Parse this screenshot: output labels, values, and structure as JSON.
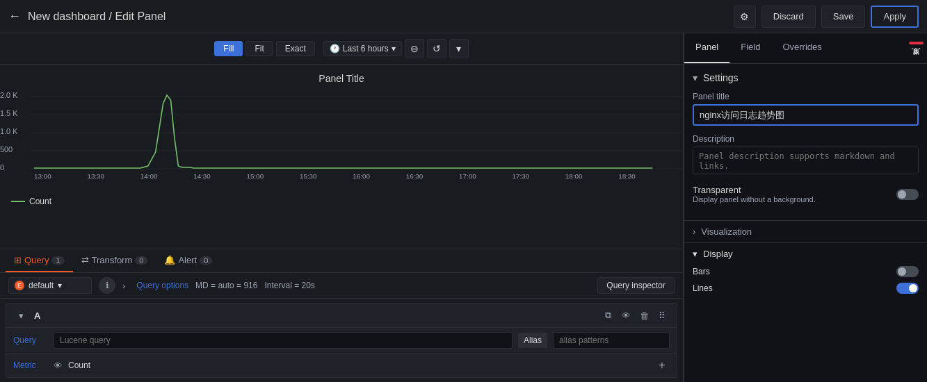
{
  "header": {
    "back_icon": "←",
    "title": "New dashboard / Edit Panel",
    "gear_icon": "⚙",
    "discard_label": "Discard",
    "save_label": "Save",
    "apply_label": "Apply"
  },
  "chart_toolbar": {
    "fill_label": "Fill",
    "fit_label": "Fit",
    "exact_label": "Exact",
    "clock_icon": "🕐",
    "time_range": "Last 6 hours",
    "chevron_down": "▾",
    "zoom_out_icon": "⊖",
    "refresh_icon": "↺",
    "more_icon": "▾"
  },
  "chart": {
    "title": "Panel Title",
    "y_labels": [
      "2.0 K",
      "1.5 K",
      "1.0 K",
      "500",
      "0"
    ],
    "x_labels": [
      "13:00",
      "13:30",
      "14:00",
      "14:30",
      "15:00",
      "15:30",
      "16:00",
      "16:30",
      "17:00",
      "17:30",
      "18:00",
      "18:30"
    ],
    "legend_label": "Count",
    "legend_color": "#73bf69"
  },
  "query_tabs": [
    {
      "label": "Query",
      "badge": "1",
      "icon": "⊞",
      "active": true
    },
    {
      "label": "Transform",
      "badge": "0",
      "icon": "⇄",
      "active": false
    },
    {
      "label": "Alert",
      "badge": "0",
      "icon": "🔔",
      "active": false
    }
  ],
  "query_bar": {
    "datasource": "default",
    "ds_chevron": "▾",
    "info_icon": "ℹ",
    "arrow_icon": "›",
    "options_label": "Query options",
    "md_text": "MD = auto = 916",
    "interval_text": "Interval = 20s",
    "inspector_label": "Query inspector"
  },
  "query_row": {
    "collapse_icon": "▾",
    "label": "A",
    "copy_icon": "⧉",
    "eye_icon": "👁",
    "trash_icon": "🗑",
    "drag_icon": "⠿",
    "query_label": "Query",
    "query_placeholder": "Lucene query",
    "alias_label": "Alias",
    "alias_placeholder": "alias patterns",
    "metric_label": "Metric",
    "metric_eye": "👁",
    "metric_value": "Count",
    "add_icon": "+"
  },
  "right_panel": {
    "tabs": [
      {
        "label": "Panel",
        "active": true
      },
      {
        "label": "Field",
        "active": false
      },
      {
        "label": "Overrides",
        "active": false
      }
    ],
    "more_icon": "⋯",
    "settings": {
      "header": "Settings",
      "chevron": "▾",
      "panel_title_label": "Panel title",
      "panel_title_value": "nginx访问日志趋势图",
      "description_label": "Description",
      "description_placeholder": "Panel description supports markdown and links.",
      "transparent_label": "Transparent",
      "transparent_desc": "Display panel without a background."
    },
    "visualization": {
      "header": "Visualization",
      "chevron": "›"
    },
    "display": {
      "header": "Display",
      "chevron": "▾",
      "bars_label": "Bars",
      "lines_label": "Lines"
    }
  }
}
